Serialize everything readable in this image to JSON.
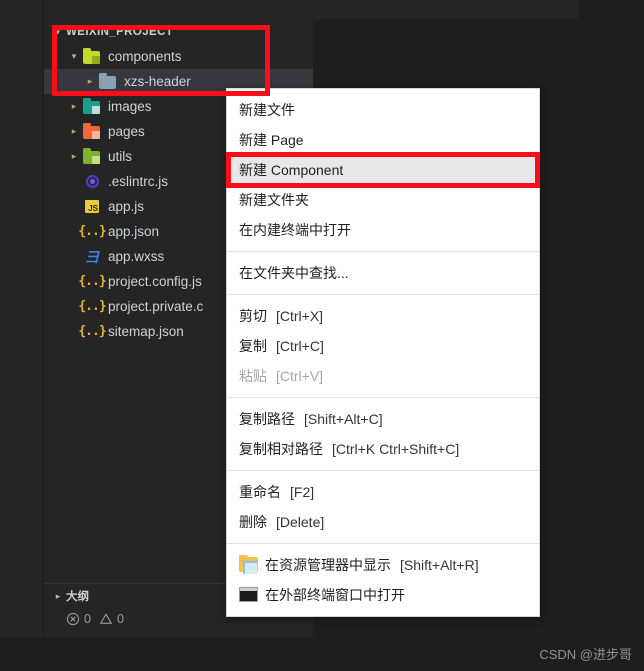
{
  "app": {
    "theme_bg": "#1e1e1e",
    "panel_bg": "#252526",
    "selection_bg": "#37373d",
    "accent_red": "#fc0d1c"
  },
  "explorer": {
    "root": {
      "label": "WEIXIN_PROJECT",
      "twisty": "▾"
    },
    "items": [
      {
        "label": "components",
        "twisty": "▾",
        "indent": 1,
        "kind": "folder",
        "color": "#c3d92e",
        "badge": "#8fae18",
        "selected": false
      },
      {
        "label": "xzs-header",
        "twisty": "▸",
        "indent": 2,
        "kind": "folder",
        "color": "#8ba0b3",
        "badge": "",
        "selected": true
      },
      {
        "label": "images",
        "twisty": "▸",
        "indent": 1,
        "kind": "folder",
        "color": "#1f9e8d",
        "badge": "#b9e0dc",
        "selected": false
      },
      {
        "label": "pages",
        "twisty": "▸",
        "indent": 1,
        "kind": "folder",
        "color": "#f2663c",
        "badge": "#f7b5a0",
        "selected": false
      },
      {
        "label": "utils",
        "twisty": "▸",
        "indent": 1,
        "kind": "folder",
        "color": "#7cb22e",
        "badge": "#c3e07a",
        "selected": false
      },
      {
        "label": ".eslintrc.js",
        "twisty": "",
        "indent": 1,
        "kind": "eslint",
        "color": "",
        "badge": "",
        "selected": false
      },
      {
        "label": "app.js",
        "twisty": "",
        "indent": 1,
        "kind": "js",
        "color": "#f0c93c",
        "badge": "",
        "selected": false
      },
      {
        "label": "app.json",
        "twisty": "",
        "indent": 1,
        "kind": "json",
        "color": "#e8b339",
        "badge": "",
        "selected": false
      },
      {
        "label": "app.wxss",
        "twisty": "",
        "indent": 1,
        "kind": "wxss",
        "color": "#2e8ae6",
        "badge": "",
        "selected": false
      },
      {
        "label": "project.config.js",
        "twisty": "",
        "indent": 1,
        "kind": "json",
        "color": "#e8b339",
        "badge": "",
        "selected": false
      },
      {
        "label": "project.private.c",
        "twisty": "",
        "indent": 1,
        "kind": "json",
        "color": "#e8b339",
        "badge": "",
        "selected": false
      },
      {
        "label": "sitemap.json",
        "twisty": "",
        "indent": 1,
        "kind": "json",
        "color": "#e8b339",
        "badge": "",
        "selected": false
      }
    ],
    "json_glyph": "{..}",
    "js_glyph": "JS",
    "wxss_glyph": "彐"
  },
  "outline": {
    "twisty": "▸",
    "label": "大纲"
  },
  "status": {
    "error_count": "0",
    "warning_count": "0",
    "watermark": "CSDN @进步哥"
  },
  "context_menu": {
    "groups": [
      {
        "items": [
          {
            "label": "新建文件",
            "key": "",
            "state": "normal"
          },
          {
            "label": "新建 Page",
            "key": "",
            "state": "normal"
          },
          {
            "label": "新建 Component",
            "key": "",
            "state": "highlighted"
          },
          {
            "label": "新建文件夹",
            "key": "",
            "state": "normal"
          },
          {
            "label": "在内建终端中打开",
            "key": "",
            "state": "normal"
          }
        ]
      },
      {
        "items": [
          {
            "label": "在文件夹中查找...",
            "key": "",
            "state": "normal"
          }
        ]
      },
      {
        "items": [
          {
            "label": "剪切",
            "key": "[Ctrl+X]",
            "state": "normal"
          },
          {
            "label": "复制",
            "key": "[Ctrl+C]",
            "state": "normal"
          },
          {
            "label": "粘贴",
            "key": "[Ctrl+V]",
            "state": "disabled"
          }
        ]
      },
      {
        "items": [
          {
            "label": "复制路径",
            "key": "[Shift+Alt+C]",
            "state": "normal"
          },
          {
            "label": "复制相对路径",
            "key": "[Ctrl+K Ctrl+Shift+C]",
            "state": "normal"
          }
        ]
      },
      {
        "items": [
          {
            "label": "重命名",
            "key": "[F2]",
            "state": "normal"
          },
          {
            "label": "删除",
            "key": "[Delete]",
            "state": "normal"
          }
        ]
      },
      {
        "items": [
          {
            "label": "在资源管理器中显示",
            "key": "[Shift+Alt+R]",
            "state": "normal",
            "icon": "explorer-icon"
          },
          {
            "label": "在外部终端窗口中打开",
            "key": "",
            "state": "normal",
            "icon": "cmd-icon"
          }
        ]
      }
    ],
    "cmd_icon_text": "C:\\."
  },
  "annotations": [
    {
      "name": "annot-tree",
      "target": "explorer-tree-top"
    },
    {
      "name": "annot-item",
      "target": "menu-item-new-component"
    }
  ]
}
